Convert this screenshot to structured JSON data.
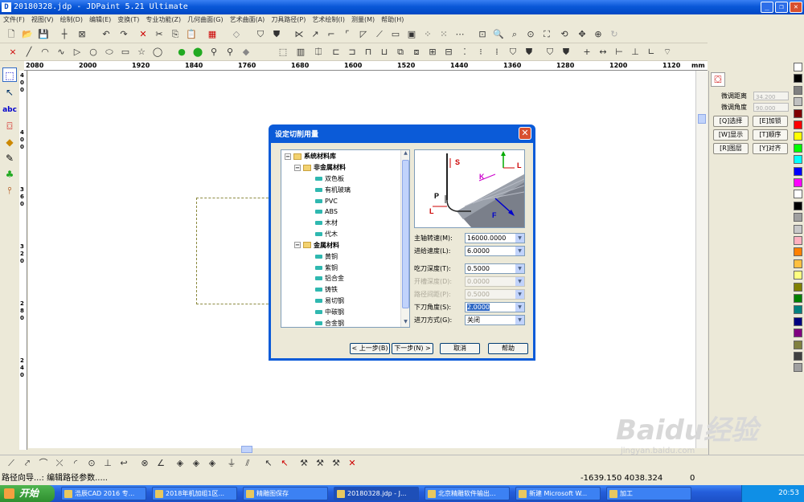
{
  "window": {
    "title": "20180328.jdp - JDPaint 5.21 Ultimate",
    "icon": "jdpaint-icon"
  },
  "menu": [
    "文件(F)",
    "视图(V)",
    "绘制(D)",
    "编辑(E)",
    "变换(T)",
    "专业功能(Z)",
    "几何曲面(G)",
    "艺术曲面(A)",
    "刀具路径(P)",
    "艺术绘制(I)",
    "测量(M)",
    "帮助(H)"
  ],
  "ruler": {
    "ticks": [
      "2080",
      "2000",
      "1920",
      "1840",
      "1760",
      "1680",
      "1600",
      "1520",
      "1440",
      "1360",
      "1280",
      "1200",
      "1120"
    ],
    "unit": "mm"
  },
  "vruler": [
    "4",
    "0",
    "0",
    "4",
    "0",
    "0",
    "3",
    "6",
    "0",
    "3",
    "2",
    "0",
    "2",
    "8",
    "0",
    "2",
    "4",
    "0"
  ],
  "right_panel": {
    "fine_dist_label": "微调距离",
    "fine_dist_value": "34.200",
    "fine_angle_label": "微调角度",
    "fine_angle_value": "90.000",
    "buttons": [
      "[Q]选择",
      "[E]加锁",
      "[W]显示",
      "[T]顺序",
      "[R]图层",
      "[Y]对齐"
    ]
  },
  "palette": [
    "#ffffff",
    "#000000",
    "#808080",
    "#c0c0c0",
    "#800000",
    "#ff0000",
    "#ffff00",
    "#00ff00",
    "#00ffff",
    "#0000ff",
    "#ff00ff",
    "#ffffff",
    "#000000",
    "#a0a0a0",
    "#c8c8c8",
    "#ffb0c0",
    "#ff8000",
    "#ffc040",
    "#ffff80",
    "#808000",
    "#008000",
    "#008080",
    "#000080",
    "#800080",
    "#808040",
    "#404040",
    "#a0a0a0"
  ],
  "dialog": {
    "title": "设定切削用量",
    "tree": {
      "root": "系统材料库",
      "groups": [
        {
          "name": "非金属材料",
          "items": [
            "双色板",
            "有机玻璃",
            "PVC",
            "ABS",
            "木材",
            "代木"
          ]
        },
        {
          "name": "金属材料",
          "items": [
            "黄铜",
            "紫铜",
            "铝合金",
            "铸铁",
            "易切钢",
            "中碳钢",
            "合金钢"
          ]
        }
      ]
    },
    "preview_labels": {
      "s": "S",
      "l_top": "L",
      "k": "K",
      "p": "P",
      "l_left": "L",
      "f": "F"
    },
    "params": [
      {
        "label": "主轴转速(M):",
        "value": "16000.0000",
        "disabled": false,
        "selected": false
      },
      {
        "label": "进给速度(L):",
        "value": "6.0000",
        "disabled": false,
        "selected": false
      },
      {
        "label": "吃刀深度(T):",
        "value": "0.5000",
        "disabled": false,
        "selected": false
      },
      {
        "label": "开槽深度(D):",
        "value": "0.0000",
        "disabled": true,
        "selected": false
      },
      {
        "label": "路径间距(P):",
        "value": "0.5000",
        "disabled": true,
        "selected": false
      },
      {
        "label": "下刀角度(S):",
        "value": "2.0000",
        "disabled": false,
        "selected": true
      },
      {
        "label": "进刀方式(G):",
        "value": "关闭",
        "disabled": false,
        "selected": false
      }
    ],
    "buttons": {
      "prev": "< 上一步(B)",
      "next": "下一步(N) >",
      "cancel": "取消",
      "help": "帮助"
    }
  },
  "status": {
    "left": "路径向导...: 编辑路径参数.....",
    "coords": "-1639.150   4038.324",
    "right": "0"
  },
  "taskbar": {
    "start": "开始",
    "tasks": [
      "浩辰CAD 2016 专...",
      "2018年机加组1区...",
      "精雕图保存",
      "20180328.jdp - J...",
      "北京精雕软件输出...",
      "新建 Microsoft W...",
      "加工"
    ],
    "active_index": 3,
    "clock": "20:53"
  },
  "watermark": {
    "brand": "Baidu经验",
    "url": "jingyan.baidu.com"
  }
}
